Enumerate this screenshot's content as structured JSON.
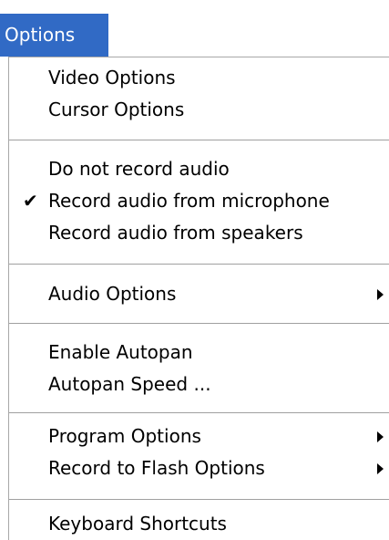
{
  "menu": {
    "title": "Options",
    "groups": [
      {
        "items": [
          {
            "label": "Video Options"
          },
          {
            "label": "Cursor Options"
          }
        ]
      },
      {
        "items": [
          {
            "label": "Do not record audio"
          },
          {
            "label": "Record audio from microphone",
            "checked": true,
            "check_glyph": "✔"
          },
          {
            "label": "Record audio from speakers"
          }
        ]
      },
      {
        "items": [
          {
            "label": "Audio Options",
            "has_submenu": true
          }
        ]
      },
      {
        "items": [
          {
            "label": "Enable Autopan"
          },
          {
            "label": "Autopan Speed ..."
          }
        ]
      },
      {
        "items": [
          {
            "label": "Program Options",
            "has_submenu": true
          },
          {
            "label": "Record to Flash Options",
            "has_submenu": true
          }
        ]
      },
      {
        "items": [
          {
            "label": "Keyboard Shortcuts"
          }
        ]
      }
    ]
  },
  "colors": {
    "title_background": "#316ac5",
    "title_text": "#ffffff",
    "menu_background": "#ffffff",
    "separator": "#a0a0a0"
  },
  "icons": {
    "check": "checkmark-icon",
    "submenu": "submenu-arrow-icon"
  }
}
